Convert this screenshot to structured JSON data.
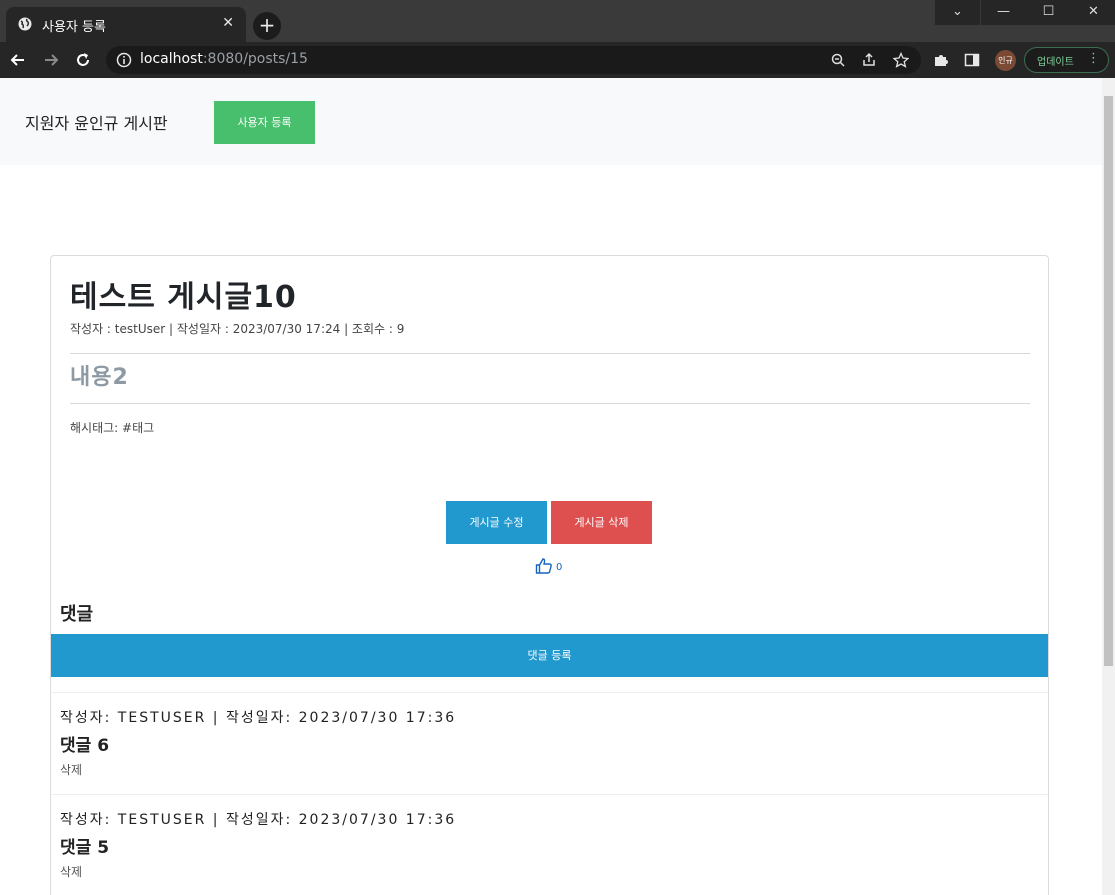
{
  "browser": {
    "tab_title": "사용자 등록",
    "url_host": "localhost",
    "url_rest": ":8080/posts/15",
    "profile_label": "인규",
    "update_label": "업데이트"
  },
  "header": {
    "brand": "지원자 윤인규 게시판",
    "register_button": "사용자 등록"
  },
  "post": {
    "title": "테스트 게시글10",
    "meta": "작성자 : testUser | 작성일자 : 2023/07/30 17:24 | 조회수 : 9",
    "content": "내용2",
    "hashtags": "해시태그: #태그",
    "edit_button": "게시글 수정",
    "delete_button": "게시글 삭제",
    "like_count": "0"
  },
  "comments": {
    "heading": "댓글",
    "register_button": "댓글 등록",
    "items": [
      {
        "meta": "작성자: testUser | 작성일자: 2023/07/30 17:36",
        "body": "댓글 6",
        "delete_label": "삭제"
      },
      {
        "meta": "작성자: testUser | 작성일자: 2023/07/30 17:36",
        "body": "댓글 5",
        "delete_label": "삭제"
      }
    ]
  },
  "colors": {
    "register_green": "#47bf6c",
    "primary_blue": "#2199cf",
    "danger_red": "#de5050"
  },
  "icons": [
    "globe-icon",
    "close-icon",
    "plus-icon",
    "back-icon",
    "forward-icon",
    "reload-icon",
    "info-icon",
    "zoom-icon",
    "share-icon",
    "star-icon",
    "extensions-icon",
    "sidepanel-icon",
    "thumbs-up-icon"
  ]
}
